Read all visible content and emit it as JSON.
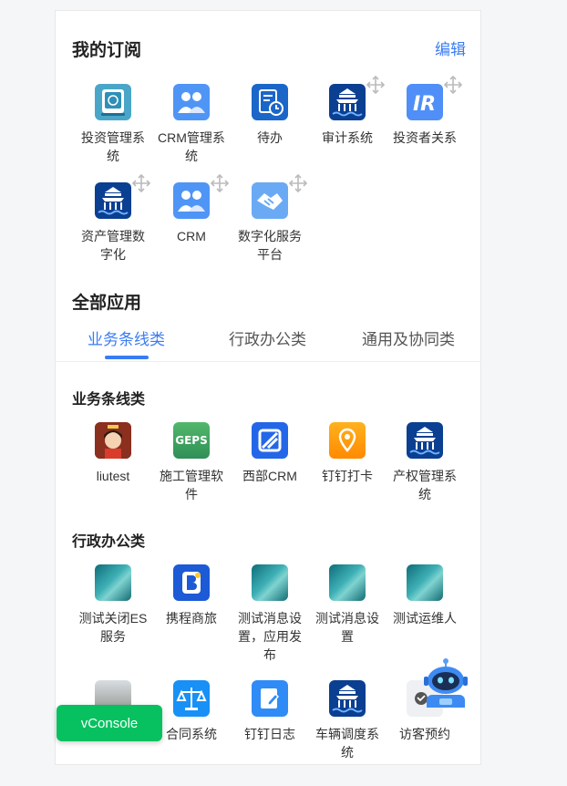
{
  "subscriptions": {
    "title": "我的订阅",
    "edit_label": "编辑",
    "items": [
      {
        "label": "投资管理系统",
        "icon": "investment-management-icon"
      },
      {
        "label": "CRM管理系统",
        "icon": "crm-people-icon"
      },
      {
        "label": "待办",
        "icon": "todo-clock-icon"
      },
      {
        "label": "审计系统",
        "icon": "temple-icon"
      },
      {
        "label": "投资者关系",
        "icon": "ir-icon"
      },
      {
        "label": "资产管理数字化",
        "icon": "temple-icon"
      },
      {
        "label": "CRM",
        "icon": "crm-people-icon"
      },
      {
        "label": "数字化服务平台",
        "icon": "handshake-icon"
      }
    ]
  },
  "all_apps": {
    "title": "全部应用",
    "tabs": [
      "业务条线类",
      "行政办公类",
      "通用及协同类"
    ],
    "active_tab": 0
  },
  "groups": [
    {
      "title": "业务条线类",
      "items": [
        {
          "label": "liutest",
          "icon": "cartoon-avatar-icon"
        },
        {
          "label": "施工管理软件",
          "icon": "geps-logo-icon",
          "icon_text": "GEPS"
        },
        {
          "label": "西部CRM",
          "icon": "crm-logo-icon"
        },
        {
          "label": "钉钉打卡",
          "icon": "location-pin-icon"
        },
        {
          "label": "产权管理系统",
          "icon": "temple-icon"
        }
      ]
    },
    {
      "title": "行政办公类",
      "items": [
        {
          "label": "测试关闭ES服务",
          "icon": "photo-thumbnail-icon"
        },
        {
          "label": "携程商旅",
          "icon": "letter-b-icon"
        },
        {
          "label": "测试消息设置，应用发布",
          "icon": "photo-thumbnail-icon"
        },
        {
          "label": "测试消息设置",
          "icon": "photo-thumbnail-icon"
        },
        {
          "label": "测试运维人",
          "icon": "photo-thumbnail-icon"
        }
      ]
    },
    {
      "items": [
        {
          "label": "",
          "icon": "castle-photo-icon"
        },
        {
          "label": "合同系统",
          "icon": "scale-icon"
        },
        {
          "label": "钉钉日志",
          "icon": "edit-log-icon"
        },
        {
          "label": "车辆调度系统",
          "icon": "temple-icon"
        },
        {
          "label": "访客预约",
          "icon": "visitor-icon"
        }
      ]
    }
  ],
  "vconsole": {
    "label": "vConsole"
  },
  "colors": {
    "accent": "#3a7cf2",
    "vconsole": "#07c160"
  }
}
